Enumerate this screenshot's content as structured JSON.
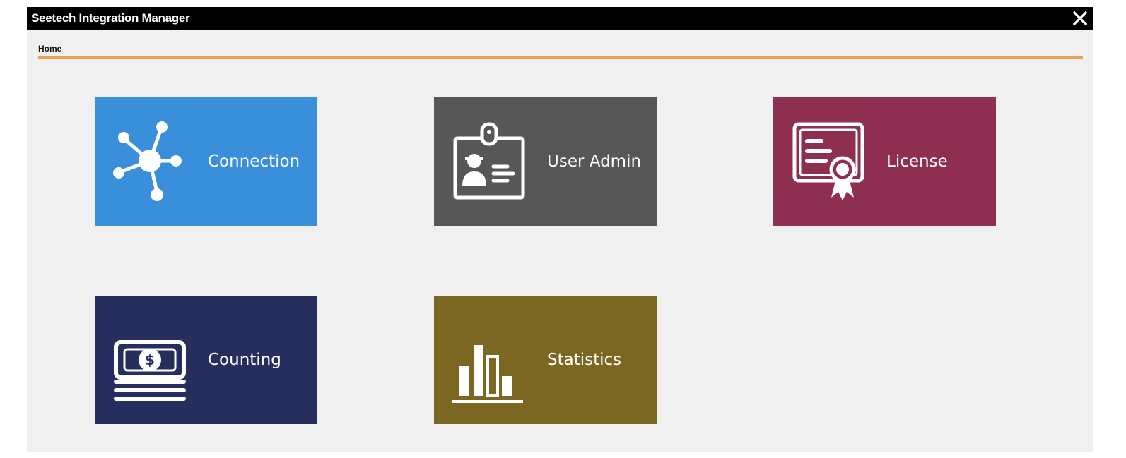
{
  "window": {
    "title": "Seetech Integration Manager",
    "close_icon": "close-icon"
  },
  "breadcrumb": {
    "label": "Home"
  },
  "colors": {
    "titlebar": "#000000",
    "background": "#f0f0f0",
    "accent_rule": "#f0a050"
  },
  "tiles": [
    {
      "label": "Connection",
      "icon": "network-hub-icon",
      "color": "#3a8fdb"
    },
    {
      "label": "User Admin",
      "icon": "id-badge-icon",
      "color": "#575757"
    },
    {
      "label": "License",
      "icon": "certificate-icon",
      "color": "#8e2e50"
    },
    {
      "label": "Counting",
      "icon": "money-stack-icon",
      "color": "#262e5e"
    },
    {
      "label": "Statistics",
      "icon": "bar-chart-icon",
      "color": "#7b6722"
    }
  ]
}
